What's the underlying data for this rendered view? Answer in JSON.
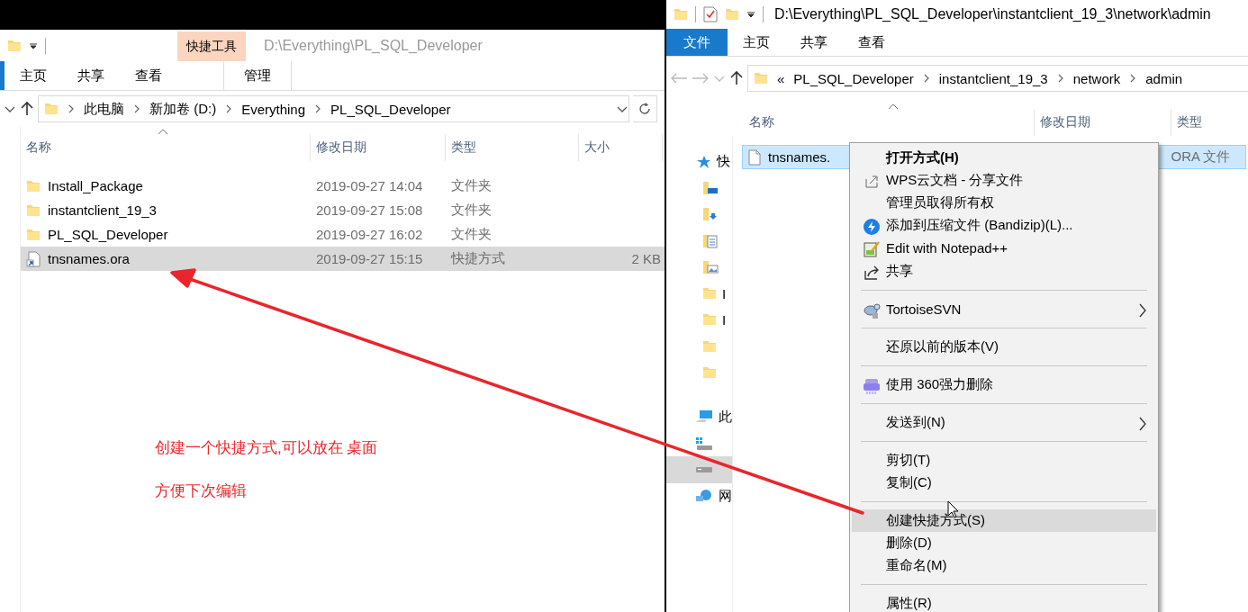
{
  "left_window": {
    "title": "D:\\Everything\\PL_SQL_Developer",
    "context_tab": "快捷工具",
    "ribbon_tabs": [
      {
        "label": "主页",
        "kind": "tab",
        "selected": false
      },
      {
        "label": "共享",
        "kind": "tab",
        "selected": false
      },
      {
        "label": "查看",
        "kind": "tab",
        "selected": false
      },
      {
        "label": "管理",
        "kind": "context",
        "selected": false
      }
    ],
    "breadcrumb": [
      "此电脑",
      "新加卷 (D:)",
      "Everything",
      "PL_SQL_Developer"
    ],
    "columns": [
      "名称",
      "修改日期",
      "类型",
      "大小"
    ],
    "rows": [
      {
        "kind": "folder",
        "name": "Install_Package",
        "modified": "2019-09-27 14:04",
        "type": "文件夹",
        "selected": false
      },
      {
        "kind": "folder",
        "name": "instantclient_19_3",
        "modified": "2019-09-27 15:08",
        "type": "文件夹",
        "selected": false
      },
      {
        "kind": "folder",
        "name": "PL_SQL_Developer",
        "modified": "2019-09-27 16:02",
        "type": "文件夹",
        "selected": false
      },
      {
        "kind": "shortcut",
        "name": "tnsnames.ora",
        "modified": "2019-09-27 15:15",
        "type": "快捷方式",
        "size": "2 KB",
        "selected": true
      }
    ]
  },
  "right_window": {
    "title": "D:\\Everything\\PL_SQL_Developer\\instantclient_19_3\\network\\admin",
    "ribbon_tabs": [
      {
        "label": "文件",
        "kind": "file",
        "selected": false
      },
      {
        "label": "主页",
        "kind": "tab",
        "selected": false
      },
      {
        "label": "共享",
        "kind": "tab",
        "selected": false
      },
      {
        "label": "查看",
        "kind": "tab",
        "selected": false
      }
    ],
    "breadcrumb_overflow": "«",
    "breadcrumb": [
      "PL_SQL_Developer",
      "instantclient_19_3",
      "network",
      "admin"
    ],
    "sidebar_quick_access": [
      {
        "kind": "star",
        "label": "快",
        "selected": false
      },
      {
        "kind": "desktop",
        "selected": false
      },
      {
        "kind": "download",
        "selected": false
      },
      {
        "kind": "document",
        "selected": false
      },
      {
        "kind": "pictures",
        "selected": false
      },
      {
        "kind": "folder",
        "label": "I",
        "selected": false
      },
      {
        "kind": "folder",
        "label": "I",
        "selected": false
      },
      {
        "kind": "folder",
        "selected": false
      },
      {
        "kind": "folder",
        "selected": false
      }
    ],
    "sidebar_devices": [
      {
        "kind": "pc",
        "label": "此",
        "selected": false
      },
      {
        "kind": "windrive",
        "selected": false
      },
      {
        "kind": "drive",
        "selected": true
      },
      {
        "kind": "network",
        "label": "网",
        "selected": false
      }
    ],
    "columns": [
      "名称",
      "修改日期",
      "类型"
    ],
    "rows": [
      {
        "kind": "file",
        "name": "tnsnames.",
        "type": "ORA 文件",
        "selected": true
      }
    ]
  },
  "context_menu": [
    {
      "kind": "plain",
      "label": "打开方式(H)",
      "default": true,
      "submenu": false,
      "selected": false
    },
    {
      "kind": "wps",
      "label": "WPS云文档 - 分享文件",
      "default": false,
      "submenu": false,
      "selected": false
    },
    {
      "kind": "plain",
      "label": "管理员取得所有权",
      "default": false,
      "submenu": false,
      "selected": false
    },
    {
      "kind": "bandizip",
      "label": "添加到压缩文件 (Bandizip)(L)...",
      "default": false,
      "submenu": false,
      "selected": false
    },
    {
      "kind": "notepad",
      "label": "Edit with Notepad++",
      "default": false,
      "submenu": false,
      "selected": false
    },
    {
      "kind": "share",
      "label": "共享",
      "default": false,
      "submenu": false,
      "selected": false
    },
    {
      "kind": "separator"
    },
    {
      "kind": "svn",
      "label": "TortoiseSVN",
      "default": false,
      "submenu": true,
      "selected": false
    },
    {
      "kind": "separator"
    },
    {
      "kind": "plain",
      "label": "还原以前的版本(V)",
      "default": false,
      "submenu": false,
      "selected": false
    },
    {
      "kind": "separator"
    },
    {
      "kind": "shredder",
      "label": "使用 360强力删除",
      "default": false,
      "submenu": false,
      "selected": false
    },
    {
      "kind": "separator"
    },
    {
      "kind": "plain",
      "label": "发送到(N)",
      "default": false,
      "submenu": true,
      "selected": false
    },
    {
      "kind": "separator"
    },
    {
      "kind": "plain",
      "label": "剪切(T)",
      "default": false,
      "submenu": false,
      "selected": false
    },
    {
      "kind": "plain",
      "label": "复制(C)",
      "default": false,
      "submenu": false,
      "selected": false
    },
    {
      "kind": "separator"
    },
    {
      "kind": "plain",
      "label": "创建快捷方式(S)",
      "default": false,
      "submenu": false,
      "selected": true
    },
    {
      "kind": "plain",
      "label": "删除(D)",
      "default": false,
      "submenu": false,
      "selected": false
    },
    {
      "kind": "plain",
      "label": "重命名(M)",
      "default": false,
      "submenu": false,
      "selected": false
    },
    {
      "kind": "separator"
    },
    {
      "kind": "plain",
      "label": "属性(R)",
      "default": false,
      "submenu": false,
      "selected": false
    }
  ],
  "annotations": [
    "创建一个快捷方式,可以放在 桌面",
    "方便下次编辑"
  ]
}
